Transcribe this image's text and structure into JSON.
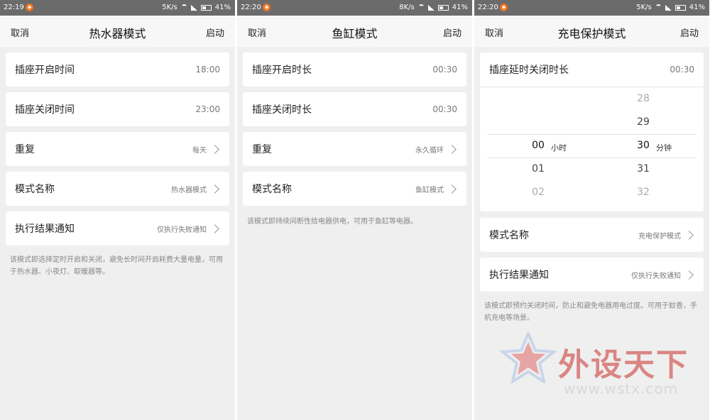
{
  "status": {
    "p1": {
      "time": "22:19",
      "speed": "5K/s",
      "battery": "41%"
    },
    "p2": {
      "time": "22:20",
      "speed": "8K/s",
      "battery": "41%"
    },
    "p3": {
      "time": "22:20",
      "speed": "5K/s",
      "battery": "41%"
    }
  },
  "panel1": {
    "cancel": "取消",
    "title": "热水器模式",
    "start": "启动",
    "rows": [
      {
        "label": "插座开启时间",
        "value": "18:00"
      },
      {
        "label": "插座关闭时间",
        "value": "23:00"
      },
      {
        "label": "重复",
        "value": "每天"
      },
      {
        "label": "模式名称",
        "value": "热水器模式"
      },
      {
        "label": "执行结果通知",
        "value": "仅执行失败通知"
      }
    ],
    "note": "该模式即选择定时开启和关闭，避免长时间开启耗费大量电量，可用于热水器、小夜灯、取暖器等。"
  },
  "panel2": {
    "cancel": "取消",
    "title": "鱼缸模式",
    "start": "启动",
    "rows": [
      {
        "label": "插座开启时长",
        "value": "00:30"
      },
      {
        "label": "插座关闭时长",
        "value": "00:30"
      },
      {
        "label": "重复",
        "value": "永久循环"
      },
      {
        "label": "模式名称",
        "value": "鱼缸模式"
      }
    ],
    "note": "该模式即持续间断性给电器供电，可用于鱼缸等电器。"
  },
  "panel3": {
    "cancel": "取消",
    "title": "充电保护模式",
    "start": "启动",
    "delay_label": "插座延时关闭时长",
    "delay_value": "00:30",
    "picker": {
      "hours": [
        "00",
        "01",
        "02"
      ],
      "hour_unit": "小时",
      "minutes": [
        "28",
        "29",
        "30",
        "31",
        "32"
      ],
      "minute_unit": "分钟",
      "selected_hour": "00",
      "selected_minute": "30"
    },
    "rows": [
      {
        "label": "模式名称",
        "value": "充电保护模式"
      },
      {
        "label": "执行结果通知",
        "value": "仅执行失败通知"
      }
    ],
    "note": "该模式即预约关闭时间，防止和避免电器用电过度。可用于蚊香，手机充电等场景。"
  },
  "watermark": {
    "text": "外设天下",
    "url": "www.wstx.com"
  },
  "colors": {
    "statusbar": "#6b6b6b",
    "notif": "#f2711c",
    "watermark_red": "#c9302c"
  },
  "icons": [
    "chevron-right-icon",
    "wifi-icon",
    "signal-icon",
    "battery-icon",
    "star-logo-icon"
  ]
}
